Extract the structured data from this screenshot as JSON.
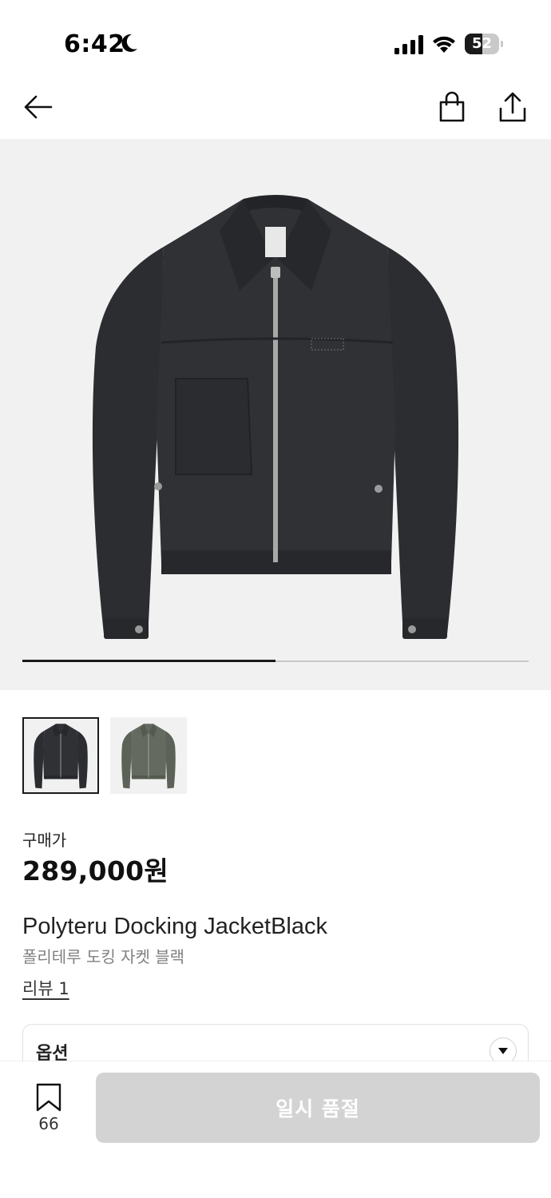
{
  "status_bar": {
    "time": "6:42",
    "battery": "52",
    "battery_level": 0.52,
    "icons": [
      "moon-icon",
      "signal-icon",
      "wifi-icon",
      "battery-icon"
    ]
  },
  "nav": {
    "icons": [
      "back-arrow-icon",
      "shopping-bag-icon",
      "share-icon"
    ]
  },
  "gallery": {
    "slide_progress": 0.5,
    "thumbnails": [
      "jacket-black",
      "jacket-khaki"
    ],
    "selected_thumbnail": 0
  },
  "product": {
    "price_label": "구매가",
    "price": "289,000원",
    "name": "Polyteru Docking JacketBlack",
    "name_ko": "폴리테루 도킹 자켓 블랙",
    "review_link": "리뷰 1"
  },
  "options": {
    "label": "옵션"
  },
  "bottom_bar": {
    "wishlist_count": "66",
    "buy_label": "일시 품절"
  },
  "colors": {
    "accent": "#1a1a1a",
    "disabled_button": "#d3d3d3",
    "image_bg": "#f1f1f1",
    "jacket_black": "#2b2d30",
    "jacket_khaki": "#5d6258"
  }
}
